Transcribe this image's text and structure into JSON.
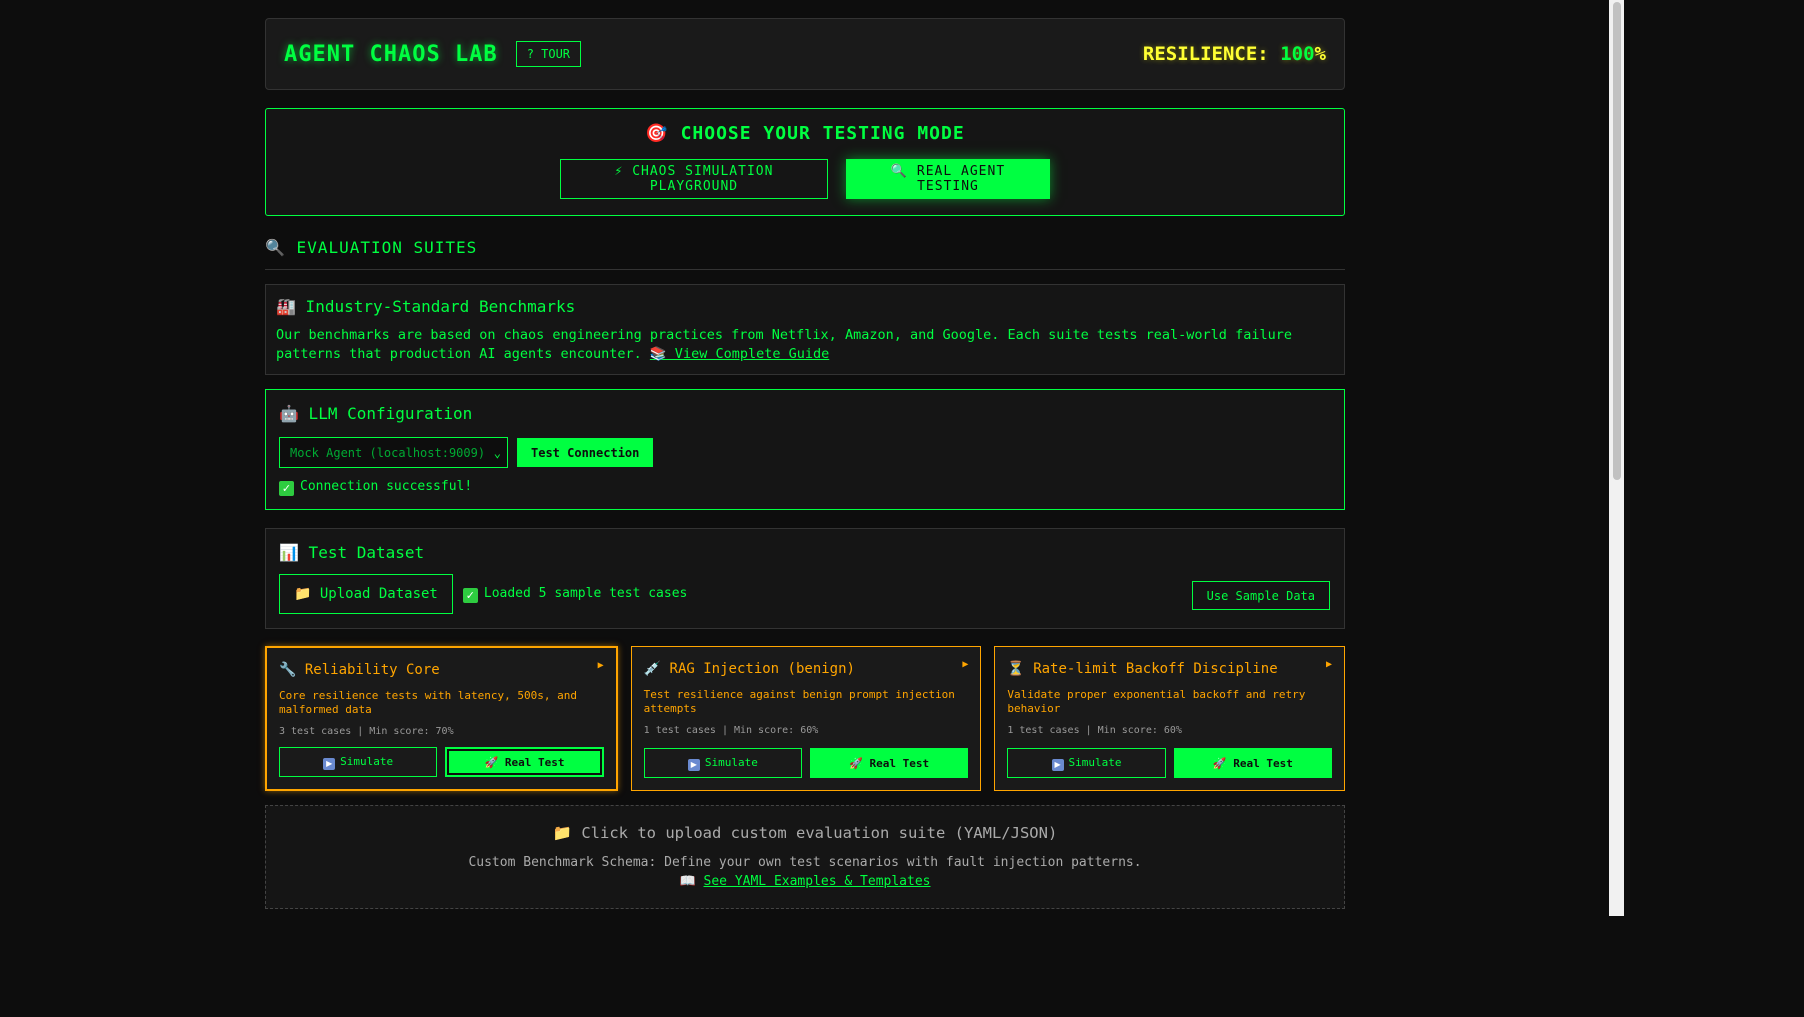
{
  "header": {
    "title": "AGENT CHAOS LAB",
    "tour_label": "? TOUR",
    "resilience_label": "RESILIENCE:",
    "resilience_value": "100",
    "resilience_suffix": "%"
  },
  "mode": {
    "title": "🎯 CHOOSE YOUR TESTING MODE",
    "playground_label": "⚡ CHAOS SIMULATION PLAYGROUND",
    "real_label": "🔍 REAL AGENT TESTING"
  },
  "eval_suites_title": "🔍 EVALUATION SUITES",
  "benchmarks": {
    "heading": "🏭 Industry-Standard Benchmarks",
    "text": "Our benchmarks are based on chaos engineering practices from Netflix, Amazon, and Google. Each suite tests real-world failure patterns that production AI agents encounter. ",
    "link": "📚 View Complete Guide"
  },
  "llm": {
    "heading": "🤖 LLM Configuration",
    "select_value": "Mock Agent (localhost:9009)",
    "test_label": "Test Connection",
    "status": "Connection successful!"
  },
  "dataset": {
    "heading": "📊 Test Dataset",
    "upload_label": "📁 Upload Dataset",
    "status": "Loaded 5 sample test cases",
    "sample_label": "Use Sample Data"
  },
  "suites": [
    {
      "title": "🔧 Reliability Core",
      "desc": "Core resilience tests with latency, 500s, and malformed data",
      "meta": "3 test cases | Min score: 70%",
      "sim_label": "Simulate",
      "real_label": "🚀 Real Test"
    },
    {
      "title": "💉 RAG Injection (benign)",
      "desc": "Test resilience against benign prompt injection attempts",
      "meta": "1 test cases | Min score: 60%",
      "sim_label": "Simulate",
      "real_label": "🚀 Real Test"
    },
    {
      "title": "⏳ Rate-limit Backoff Discipline",
      "desc": "Validate proper exponential backoff and retry behavior",
      "meta": "1 test cases | Min score: 60%",
      "sim_label": "Simulate",
      "real_label": "🚀 Real Test"
    }
  ],
  "custom": {
    "heading": "📁 Click to upload custom evaluation suite (YAML/JSON)",
    "text": "Custom Benchmark Schema: Define your own test scenarios with fault injection patterns.",
    "link_prefix": "📖 ",
    "link": "See YAML Examples & Templates"
  }
}
